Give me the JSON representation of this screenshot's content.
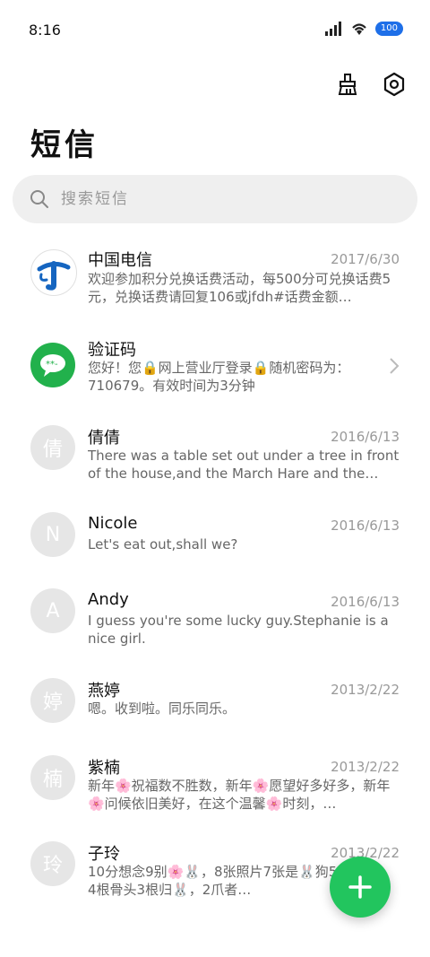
{
  "status": {
    "time": "8:16",
    "battery": "100"
  },
  "header": {
    "title": "短信"
  },
  "search": {
    "placeholder": "搜索短信"
  },
  "messages": [
    {
      "name": "中国电信",
      "date": "2017/6/30",
      "preview": "欢迎参加积分兑换话费活动，每500分可兑换话费5元，兑换话费请回复106或jfdh#话费金额…",
      "avatar": "telecom-logo"
    },
    {
      "name": "验证码",
      "date": "",
      "preview": "您好！您🔒网上营业厅登录🔒随机密码为：710679。有效时间为3分钟",
      "avatar": "chat-bubble"
    },
    {
      "name": "倩倩",
      "date": "2016/6/13",
      "preview": "There was a table set out under a tree in front of the house,and the March Hare and the Hatter…",
      "avatar_text": "倩"
    },
    {
      "name": "Nicole",
      "date": "2016/6/13",
      "preview": "Let's eat out,shall we?",
      "avatar_text": "N"
    },
    {
      "name": "Andy",
      "date": "2016/6/13",
      "preview": "I guess you're some lucky guy.Stephanie is a nice girl.",
      "avatar_text": "A"
    },
    {
      "name": "燕婷",
      "date": "2013/2/22",
      "preview": "嗯。收到啦。同乐同乐。",
      "avatar_text": "婷"
    },
    {
      "name": "紫楠",
      "date": "2013/2/22",
      "preview": "新年🌸祝福数不胜数，新年🌸愿望好多好多，新年🌸问候依旧美好，在这个温馨🌸时刻，…",
      "avatar_text": "楠"
    },
    {
      "name": "子玲",
      "date": "2013/2/22",
      "preview": "10分想念9别🌸🐰，8张照片7张是🐰狗5只像🐰，4根骨头3根归🐰，2爪者…",
      "avatar_text": "玲"
    }
  ],
  "colors": {
    "accent": "#22c55e",
    "telecom_blue": "#1565c0",
    "verify_green": "#22b14c"
  }
}
